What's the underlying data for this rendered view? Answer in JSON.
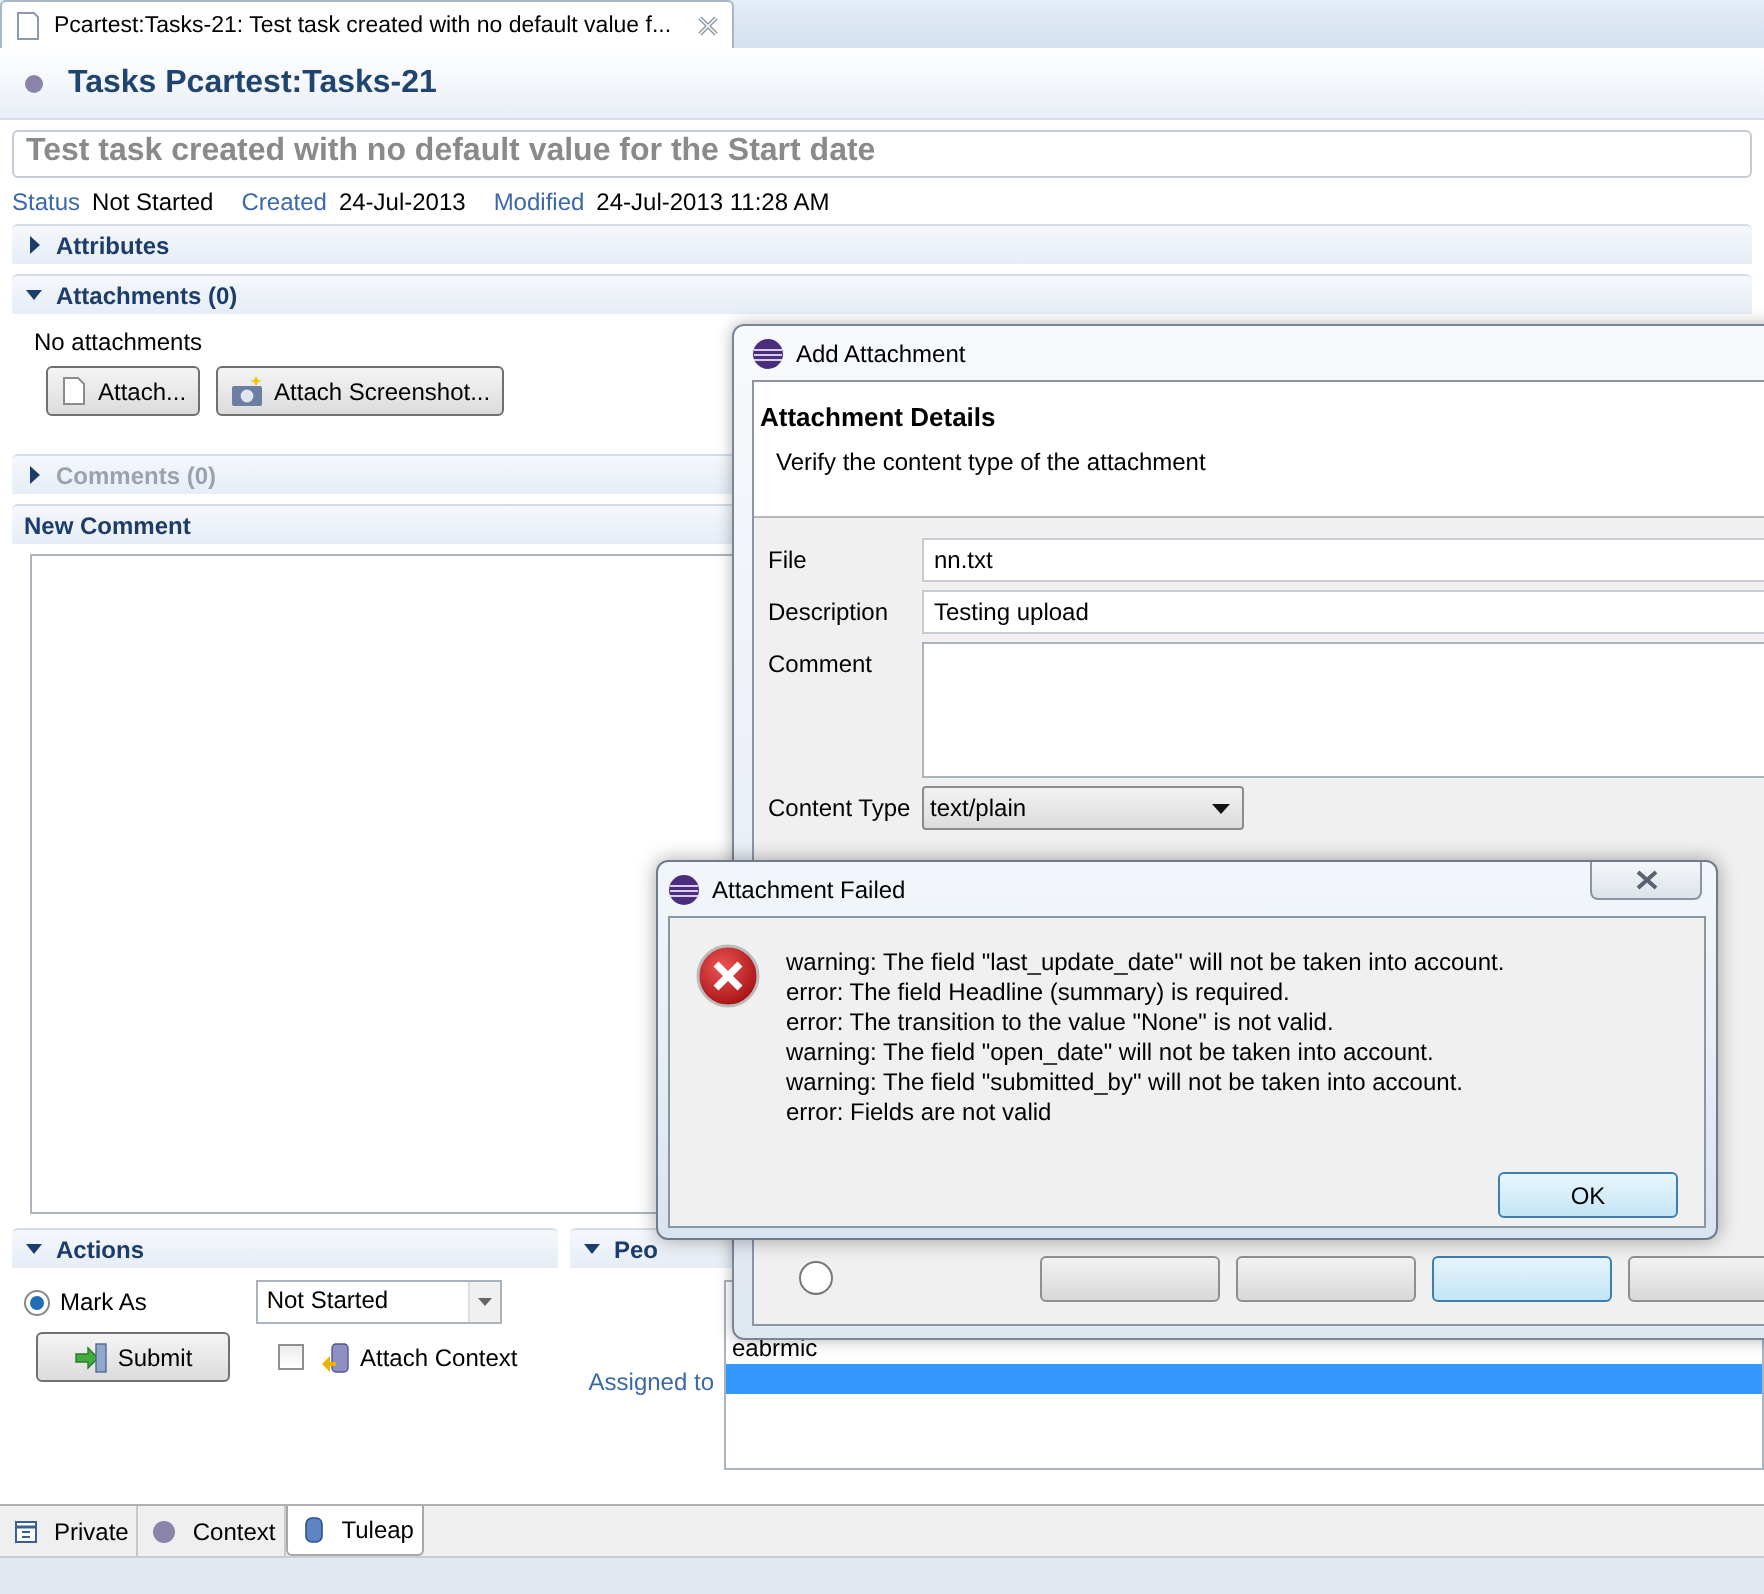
{
  "editor_tab": {
    "title": "Pcartest:Tasks-21: Test task created with no default value f...",
    "selected": true
  },
  "header": {
    "title": "Tasks Pcartest:Tasks-21"
  },
  "summary": {
    "value": "Test task created with no default value for the Start date"
  },
  "meta": [
    {
      "label": "Status",
      "value": "Not Started"
    },
    {
      "label": "Created",
      "value": "24-Jul-2013"
    },
    {
      "label": "Modified",
      "value": "24-Jul-2013 11:28 AM"
    }
  ],
  "attributes": {
    "title": "Attributes",
    "expanded": false
  },
  "attachments": {
    "title": "Attachments (0)",
    "expanded": true,
    "empty_text": "No attachments",
    "buttons": [
      "Attach...",
      "Attach Screenshot..."
    ]
  },
  "comments": {
    "title": "Comments (0)",
    "expanded": false,
    "disabled": true
  },
  "new_comment": {
    "title": "New Comment"
  },
  "actions": {
    "title": "Actions",
    "expanded": true,
    "mark_as": {
      "label": "Mark As",
      "selected": true,
      "value": "Not Started"
    },
    "submit": "Submit",
    "attach_context": {
      "label": "Attach Context",
      "checked": false
    }
  },
  "people": {
    "title": "Peo",
    "expanded": true,
    "assigned_label": "Assigned to",
    "rows": [
      {
        "label": "eabrmic",
        "selected": false
      },
      {
        "selected": true
      }
    ]
  },
  "bottom_tabs": [
    {
      "label": "Private",
      "selected": false
    },
    {
      "label": "Context",
      "selected": false
    },
    {
      "label": "Tuleap",
      "selected": true
    }
  ],
  "add_dialog": {
    "title": "Add Attachment",
    "heading": "Attachment Details",
    "description": "Verify the content type of the attachment",
    "fields": [
      {
        "label": "File",
        "kind": "text",
        "value": "nn.txt"
      },
      {
        "label": "Description",
        "kind": "text",
        "value": "Testing upload"
      },
      {
        "label": "Comment",
        "kind": "textarea"
      },
      {
        "label": "Content Type",
        "kind": "select",
        "value": "text/plain"
      }
    ]
  },
  "error_dialog": {
    "title": "Attachment Failed",
    "messages": [
      "warning: The field \"last_update_date\" will not be taken into account.",
      "error: The field Headline (summary) is required.",
      "error: The transition to the value \"None\" is not valid.",
      "warning: The field \"open_date\" will not be taken into account.",
      "warning: The field \"submitted_by\" will not be taken into account.",
      "error: Fields are not valid"
    ],
    "button": "OK"
  }
}
